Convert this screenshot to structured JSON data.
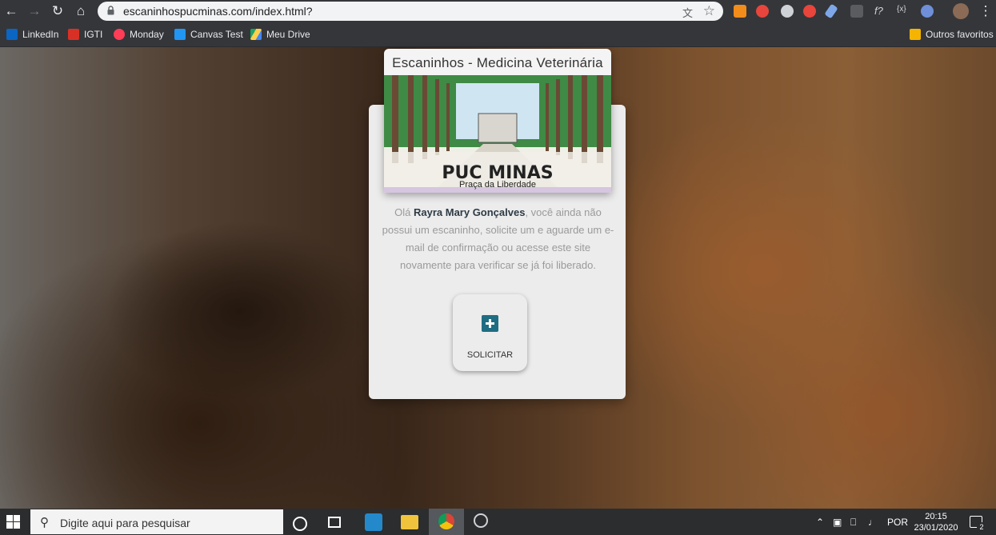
{
  "browser": {
    "url": "escaninhospucminas.com/index.html?",
    "bookmarks": [
      {
        "label": "LinkedIn",
        "icon": "linkedin-icon",
        "color": "#0a66c2"
      },
      {
        "label": "IGTI",
        "icon": "gmail-icon",
        "color": "#d93025"
      },
      {
        "label": "Monday",
        "icon": "monday-icon",
        "color": "#ff3d57"
      },
      {
        "label": "Canvas Test",
        "icon": "canvas-icon",
        "color": "#2196f3"
      },
      {
        "label": "Meu Drive",
        "icon": "drive-icon",
        "color": "#1fa463"
      }
    ],
    "other_bookmarks": "Outros favoritos"
  },
  "page": {
    "header_title": "Escaninhos - Medicina Veterinária",
    "logo_name": "PUC MINAS",
    "logo_subtitle": "Praça da Liberdade",
    "message_prefix": "Olá ",
    "user_name": "Rayra Mary Gonçalves",
    "message_suffix": ", você ainda não possui um escaninho, solicite um e aguarde um e-mail de confirmação ou acesse este site novamente para verificar se já foi liberado.",
    "request_button": "SOLICITAR",
    "accent_color": "#1f6d83"
  },
  "taskbar": {
    "search_placeholder": "Digite aqui para pesquisar",
    "language": "POR",
    "time": "20:15",
    "date": "23/01/2020",
    "notification_count": "2"
  }
}
